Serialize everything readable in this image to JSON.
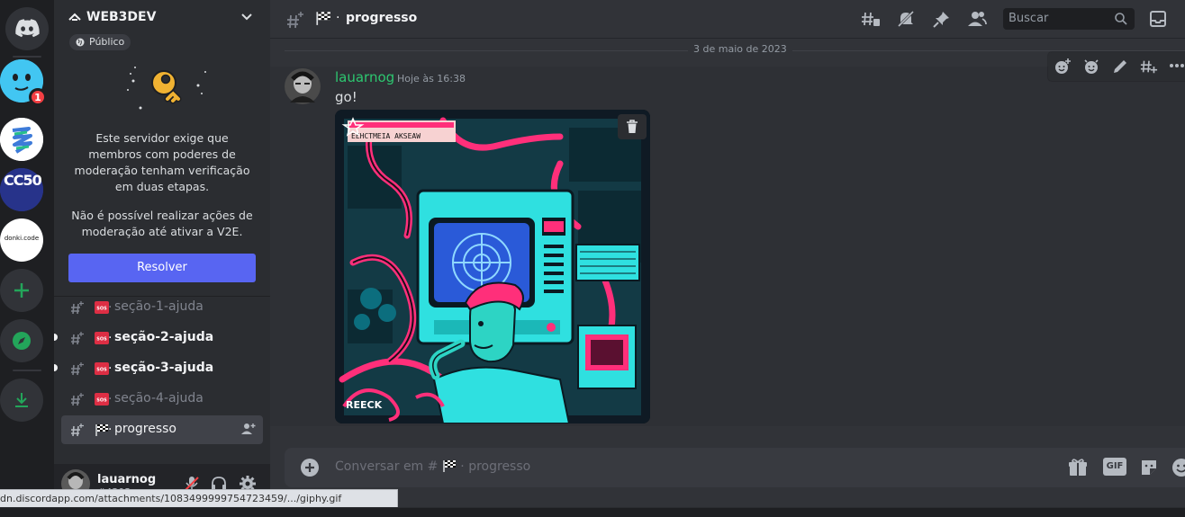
{
  "servers": {
    "items": [
      {
        "label": "Discord"
      },
      {
        "label": "",
        "badge": "1"
      },
      {
        "label": ""
      },
      {
        "label": "CC50"
      },
      {
        "label": "donki.code"
      }
    ],
    "add_label": "Adicionar servidor",
    "explore_label": "Explorar",
    "download_label": "Baixar apps"
  },
  "guild": {
    "name": "WEB3DEV",
    "visibility": "Público"
  },
  "notice": {
    "line1": "Este servidor exige que membros com poderes de moderação tenham verificação em duas etapas.",
    "line2": "Não é possível realizar ações de moderação até ativar a V2E.",
    "button": "Resolver"
  },
  "channels": [
    {
      "name": "seção-1-ajuda",
      "emoji": "SOS",
      "unread": false,
      "selected": false
    },
    {
      "name": "seção-2-ajuda",
      "emoji": "SOS",
      "unread": true,
      "selected": false
    },
    {
      "name": "seção-3-ajuda",
      "emoji": "SOS",
      "unread": true,
      "selected": false
    },
    {
      "name": "seção-4-ajuda",
      "emoji": "SOS",
      "unread": false,
      "selected": false
    },
    {
      "name": "progresso",
      "emoji": "flag",
      "unread": false,
      "selected": true
    }
  ],
  "user": {
    "name": "lauarnog",
    "tag": "#4303"
  },
  "topbar": {
    "channel": "progresso",
    "search_placeholder": "Buscar"
  },
  "chat": {
    "date": "3 de maio de 2023",
    "author": "lauarnog",
    "timestamp": "Hoje às 16:38",
    "text": "go!",
    "image_caption": "REECK"
  },
  "composer": {
    "placeholder_prefix": "Conversar em #",
    "placeholder_channel": "progresso",
    "gif_label": "GIF"
  },
  "status_url": "dn.discordapp.com/attachments/1083499999754723459/.../giphy.gif",
  "colors": {
    "accent": "#5865f2",
    "online": "#23a55a",
    "author": "#2dc770",
    "danger": "#f23f43"
  }
}
